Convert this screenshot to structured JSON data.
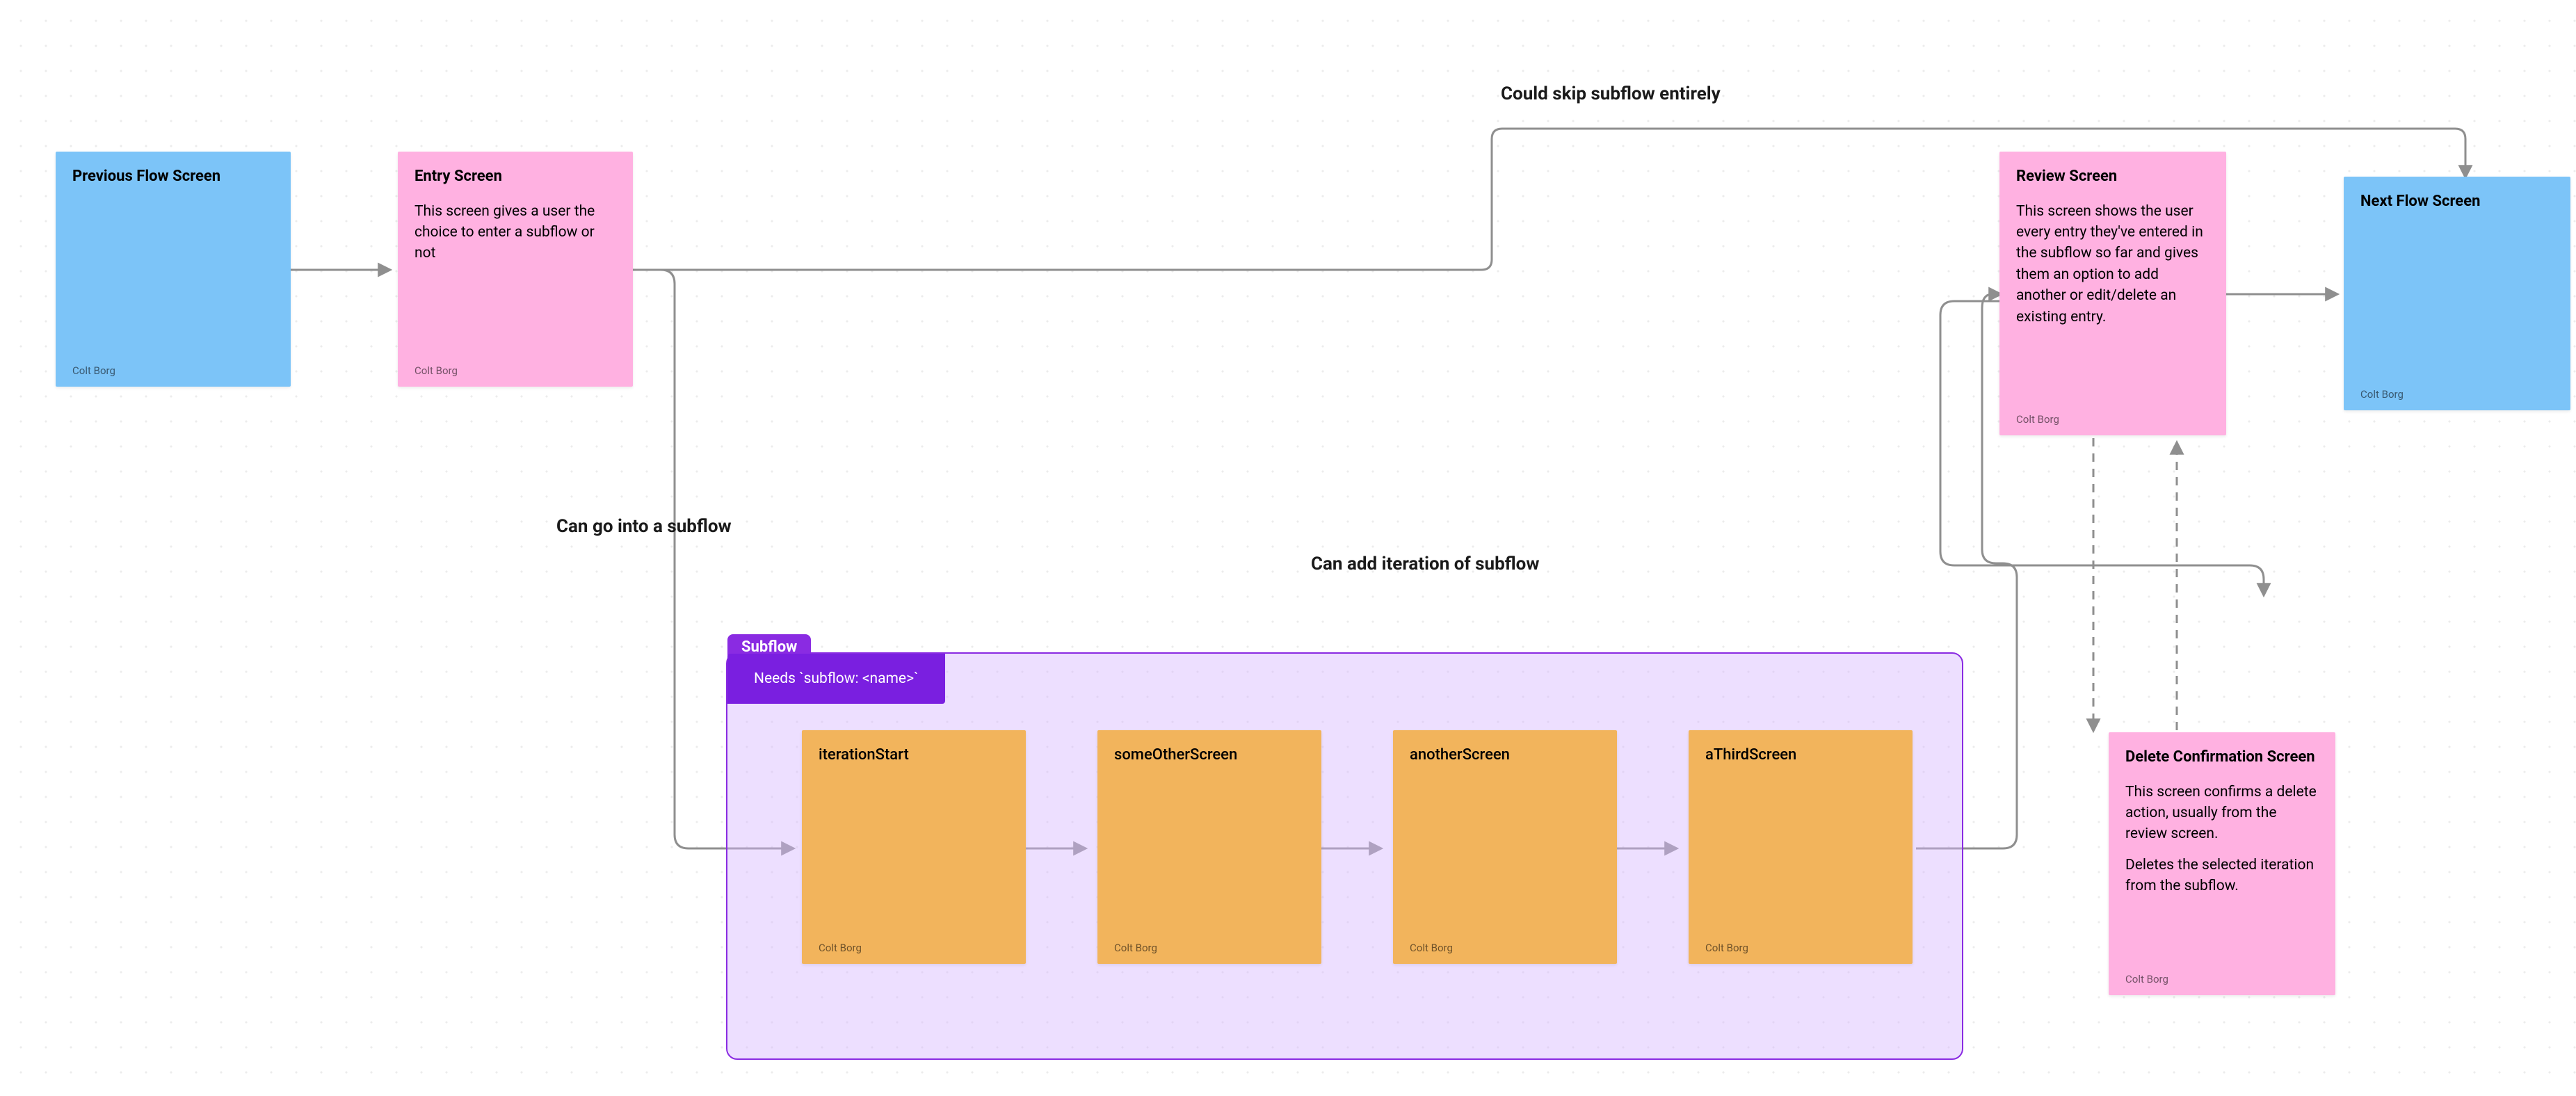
{
  "labels": {
    "skip": "Could skip subflow entirely",
    "gointo": "Can go into a subflow",
    "additer": "Can add iteration of subflow"
  },
  "subflow": {
    "tag": "Subflow",
    "note": "Needs `subflow: <name>`"
  },
  "cards": {
    "prev": {
      "title": "Previous Flow Screen",
      "author": "Colt Borg"
    },
    "entry": {
      "title": "Entry Screen",
      "body": "This screen gives a user the choice to enter a subflow or not",
      "author": "Colt Borg"
    },
    "iter0": {
      "title": "iterationStart",
      "author": "Colt Borg"
    },
    "iter1": {
      "title": "someOtherScreen",
      "author": "Colt Borg"
    },
    "iter2": {
      "title": "anotherScreen",
      "author": "Colt Borg"
    },
    "iter3": {
      "title": "aThirdScreen",
      "author": "Colt Borg"
    },
    "review": {
      "title": "Review Screen",
      "body": "This screen shows the user every entry they've entered in the subflow so far and gives them an option to add another or edit/delete an existing entry.",
      "author": "Colt Borg"
    },
    "next": {
      "title": "Next Flow Screen",
      "author": "Colt Borg"
    },
    "delete": {
      "title": "Delete Confirmation Screen",
      "body1": "This screen confirms a delete action, usually from the review screen.",
      "body2": "Deletes the selected iteration from the subflow.",
      "author": "Colt Borg"
    }
  }
}
